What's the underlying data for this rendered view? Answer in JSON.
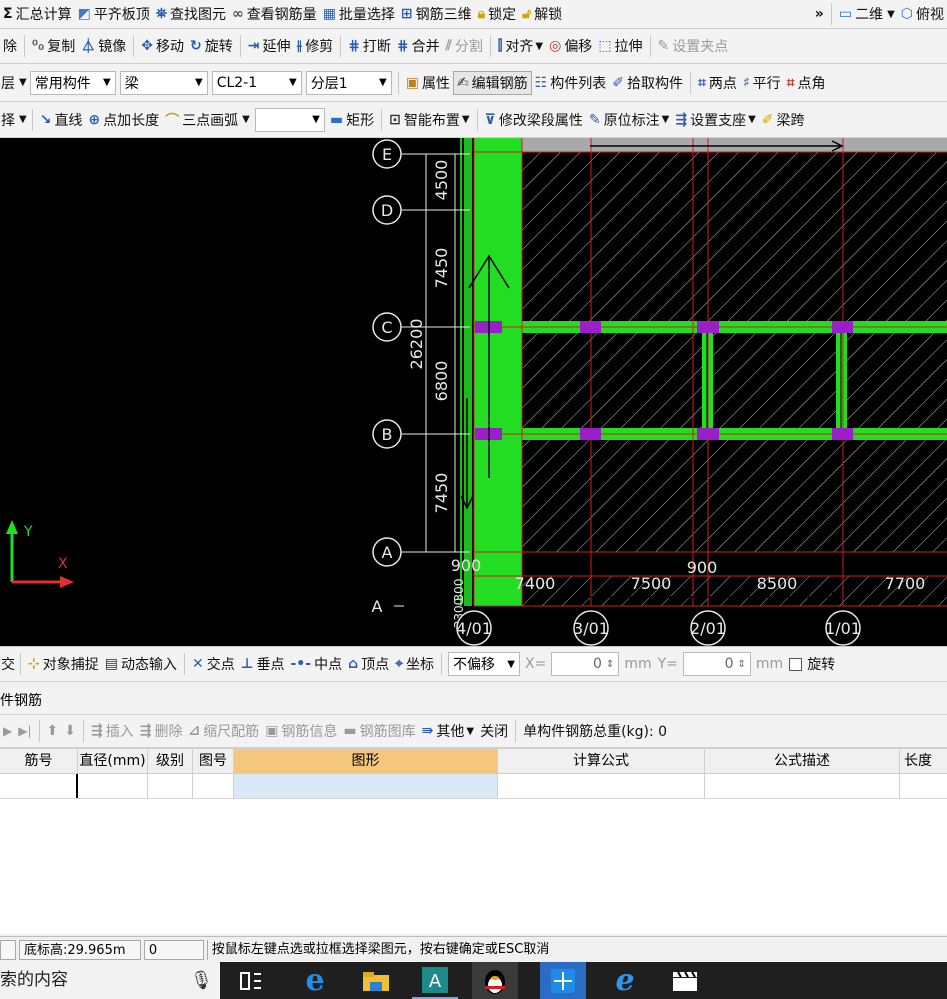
{
  "toolbar1": {
    "items": [
      "汇总计算",
      "平齐板顶",
      "查找图元",
      "查看钢筋量",
      "批量选择",
      "钢筋三维",
      "锁定",
      "解锁"
    ],
    "more": "»",
    "view_mode": "二维",
    "view_angle": "俯视"
  },
  "toolbar2": {
    "items": [
      "除",
      "复制",
      "镜像",
      "移动",
      "旋转",
      "延伸",
      "修剪",
      "打断",
      "合并",
      "分割",
      "对齐",
      "偏移",
      "拉伸",
      "设置夹点"
    ]
  },
  "toolbar3": {
    "layer": "层",
    "component_type": "常用构件",
    "component_kind": "梁",
    "component_name": "CL2-1",
    "sublayer": "分层1",
    "items": [
      "属性",
      "编辑钢筋",
      "构件列表",
      "拾取构件",
      "两点",
      "平行",
      "点角"
    ]
  },
  "toolbar4": {
    "select": "择",
    "items": [
      "直线",
      "点加长度",
      "三点画弧"
    ],
    "shape_combo": "",
    "items2": [
      "矩形",
      "智能布置",
      "修改梁段属性",
      "原位标注",
      "设置支座",
      "梁跨"
    ]
  },
  "canvas": {
    "row_axes": [
      "E",
      "D",
      "C",
      "B",
      "A",
      "A"
    ],
    "col_axes": [
      "4/01",
      "3/01",
      "2/01",
      "1/01"
    ],
    "vertical_dims": [
      "4500",
      "7450",
      "6800",
      "7450"
    ],
    "total_dim": "26200",
    "horizontal_dims": [
      "900",
      "7400",
      "7500",
      "8500",
      "7700"
    ],
    "small_dims": [
      "300",
      "3300"
    ],
    "dim_top": "900",
    "axis_y_label": "Y",
    "axis_x_label": "X",
    "colors": {
      "beam": "#22dd22",
      "grid": "#d02020",
      "support": "#9b1fc8",
      "background": "#000000"
    }
  },
  "snapbar": {
    "items": [
      "交",
      "对象捕捉",
      "动态输入",
      "交点",
      "垂点",
      "中点",
      "顶点",
      "坐标"
    ],
    "offset_mode": "不偏移",
    "x_label": "X=",
    "x_value": "0",
    "y_label": "Y=",
    "y_value": "0",
    "unit": "mm",
    "rotate_label": "旋转"
  },
  "rebar_panel": {
    "title": "件钢筋",
    "toolbar": [
      "插入",
      "删除",
      "缩尺配筋",
      "钢筋信息",
      "钢筋图库",
      "其他",
      "关闭"
    ],
    "total_weight_label": "单构件钢筋总重(kg): 0",
    "columns": [
      "筋号",
      "直径(mm)",
      "级别",
      "图号",
      "图形",
      "计算公式",
      "公式描述",
      "长度(mm)"
    ]
  },
  "status": {
    "elevation": "底标高:29.965m",
    "count": "0",
    "hint": "按鼠标左键点选或拉框选择梁图元，按右键确定或ESC取消"
  },
  "taskbar": {
    "search_text": "索的内容"
  }
}
